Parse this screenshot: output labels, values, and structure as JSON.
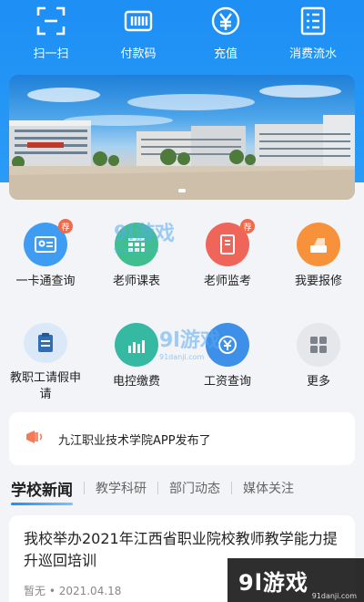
{
  "quick_bar": [
    {
      "label": "扫一扫",
      "icon": "scan-icon"
    },
    {
      "label": "付款码",
      "icon": "barcode-icon"
    },
    {
      "label": "充值",
      "icon": "yen-icon"
    },
    {
      "label": "消费流水",
      "icon": "ledger-icon"
    }
  ],
  "services": [
    {
      "label": "一卡通查询",
      "icon": "card-icon",
      "color": "#3e9df2",
      "badge": "荐"
    },
    {
      "label": "老师课表",
      "icon": "schedule-icon",
      "color": "#3fbf8f",
      "badge": ""
    },
    {
      "label": "老师监考",
      "icon": "exam-icon",
      "color": "#f0655a",
      "badge": "荐"
    },
    {
      "label": "我要报修",
      "icon": "repair-icon",
      "color": "#f7923b",
      "badge": ""
    },
    {
      "label": "教职工请假申请",
      "icon": "leave-icon",
      "color": "#dbe8f7",
      "badge": ""
    },
    {
      "label": "电控缴费",
      "icon": "electric-icon",
      "color": "#35b9a3",
      "badge": ""
    },
    {
      "label": "工资查询",
      "icon": "salary-icon",
      "color": "#3e8fe8",
      "badge": ""
    },
    {
      "label": "更多",
      "icon": "more-icon",
      "color": "#e5e7ea",
      "badge": ""
    }
  ],
  "notice": {
    "text": "九江职业技术学院APP发布了"
  },
  "news_tabs": [
    {
      "label": "学校新闻",
      "active": true
    },
    {
      "label": "教学科研",
      "active": false
    },
    {
      "label": "部门动态",
      "active": false
    },
    {
      "label": "媒体关注",
      "active": false
    }
  ],
  "news": [
    {
      "title": "我校举办2021年江西省职业院校教师教学能力提升巡回培训",
      "meta": "暂无 • 2021.04.18"
    }
  ],
  "watermark": {
    "logo": "9l游戏",
    "url": "91danji.com"
  },
  "colors": {
    "primary": "#1d8ff5",
    "background": "#f2f4f7"
  }
}
